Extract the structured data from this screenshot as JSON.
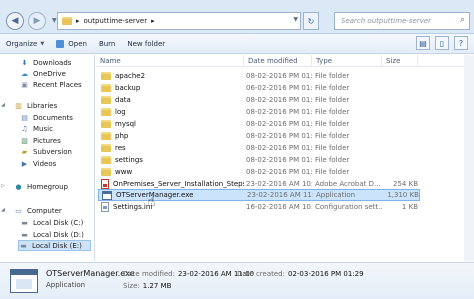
{
  "address": {
    "breadcrumb": "outputtime-server",
    "search_placeholder": "Search outputtime-server"
  },
  "toolbar": {
    "organize": "Organize",
    "open": "Open",
    "burn": "Burn",
    "new_folder": "New folder"
  },
  "nav": {
    "items": [
      {
        "label": "Downloads",
        "icon": "downloads-icon"
      },
      {
        "label": "OneDrive",
        "icon": "onedrive-icon"
      },
      {
        "label": "Recent Places",
        "icon": "recent-places-icon"
      },
      {
        "label": "Libraries",
        "icon": "libraries-icon"
      },
      {
        "label": "Documents",
        "icon": "documents-icon"
      },
      {
        "label": "Music",
        "icon": "music-icon"
      },
      {
        "label": "Pictures",
        "icon": "pictures-icon"
      },
      {
        "label": "Subversion",
        "icon": "subversion-icon"
      },
      {
        "label": "Videos",
        "icon": "videos-icon"
      },
      {
        "label": "Homegroup",
        "icon": "homegroup-icon"
      },
      {
        "label": "Computer",
        "icon": "computer-icon"
      },
      {
        "label": "Local Disk (C:)",
        "icon": "drive-icon"
      },
      {
        "label": "Local Disk (D:)",
        "icon": "drive-icon"
      },
      {
        "label": "Local Disk (E:)",
        "icon": "drive-icon"
      }
    ]
  },
  "columns": {
    "name": "Name",
    "date": "Date modified",
    "type": "Type",
    "size": "Size"
  },
  "files": [
    {
      "name": "apache2",
      "date": "08-02-2016 PM 01:...",
      "type": "File folder",
      "size": "",
      "kind": "folder"
    },
    {
      "name": "backup",
      "date": "06-02-2016 PM 01:...",
      "type": "File folder",
      "size": "",
      "kind": "folder"
    },
    {
      "name": "data",
      "date": "08-02-2016 PM 01:...",
      "type": "File folder",
      "size": "",
      "kind": "folder"
    },
    {
      "name": "log",
      "date": "08-02-2016 PM 01:...",
      "type": "File folder",
      "size": "",
      "kind": "folder"
    },
    {
      "name": "mysql",
      "date": "08-02-2016 PM 01:...",
      "type": "File folder",
      "size": "",
      "kind": "folder"
    },
    {
      "name": "php",
      "date": "08-02-2016 PM 01:...",
      "type": "File folder",
      "size": "",
      "kind": "folder"
    },
    {
      "name": "res",
      "date": "08-02-2016 PM 01:...",
      "type": "File folder",
      "size": "",
      "kind": "folder"
    },
    {
      "name": "settings",
      "date": "08-02-2016 PM 01:...",
      "type": "File folder",
      "size": "",
      "kind": "folder"
    },
    {
      "name": "www",
      "date": "08-02-2016 PM 01:...",
      "type": "File folder",
      "size": "",
      "kind": "folder"
    },
    {
      "name": "OnPremises_Server_Installation_Steps_wi...",
      "date": "23-02-2016 AM 10:...",
      "type": "Adobe Acrobat D...",
      "size": "254 KB",
      "kind": "pdf"
    },
    {
      "name": "OTServerManager.exe",
      "date": "23-02-2016 AM 11:...",
      "type": "Application",
      "size": "1,310 KB",
      "kind": "exe"
    },
    {
      "name": "Settings.ini",
      "date": "16-02-2016 AM 10:...",
      "type": "Configuration sett...",
      "size": "1 KB",
      "kind": "ini"
    }
  ],
  "details": {
    "filename": "OTServerManager.exe",
    "filetype": "Application",
    "modified_label": "Date modified:",
    "modified_value": "23-02-2016 AM 11:00",
    "size_label": "Size:",
    "size_value": "1.27 MB",
    "created_label": "Date created:",
    "created_value": "02-03-2016 PM 01:29"
  },
  "colors": {
    "selection": "#cce4fb",
    "selection_border": "#7eb4ea",
    "folder": "#e9c659"
  }
}
